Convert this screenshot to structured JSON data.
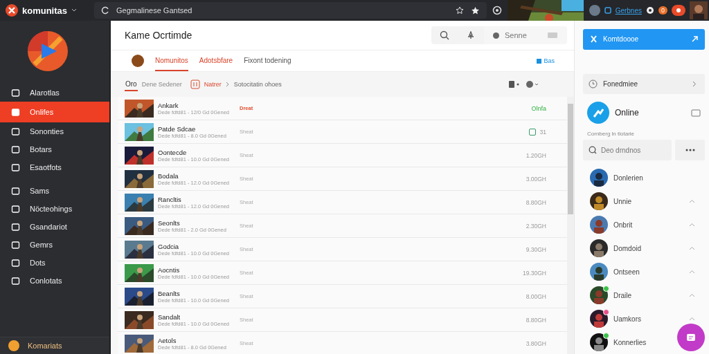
{
  "top_bar": {
    "brand": "komunitas",
    "address": "Gegmalinese Gantsed",
    "account": "Gerbnes",
    "notifications": "0"
  },
  "sidebar": {
    "items": [
      {
        "label": "Alarotlas",
        "selected": false
      },
      {
        "label": "Onlifes",
        "selected": true
      },
      {
        "label": "Sononties",
        "selected": false
      },
      {
        "label": "Botars",
        "selected": false
      },
      {
        "label": "Esaotfots",
        "selected": false
      },
      {
        "label": "Sams",
        "selected": false
      },
      {
        "label": "Nöcteohings",
        "selected": false
      },
      {
        "label": "Gsandariot",
        "selected": false
      },
      {
        "label": "Gemrs",
        "selected": false
      },
      {
        "label": "Dots",
        "selected": false
      },
      {
        "label": "Conlotats",
        "selected": false
      }
    ],
    "footer": "Komariats"
  },
  "main": {
    "title": "Kame Ocrtimde",
    "search_placeholder": "Senne",
    "tabs": [
      {
        "label": "Nomunitos",
        "selected": true
      },
      {
        "label": "Adotsbfare",
        "selected": false
      },
      {
        "label": "Fixont todening",
        "selected": false
      }
    ],
    "tabs_action": "Bas",
    "filter": {
      "label": "Oro",
      "hint": "Dene Sedener"
    },
    "breadcrumb": [
      "Natrer",
      "Sotocitatin ohoes"
    ],
    "rows": [
      {
        "title": "Ankark",
        "subtitle": "Dede fdfd81 - 12/0 Gd 0Gened",
        "tag": "Dreat",
        "tag_highlight": true,
        "kind": "status",
        "value": "Olnfa"
      },
      {
        "title": "Patde Sdcae",
        "subtitle": "Dede fdfd81 - 8.0 Gd 0Gened",
        "tag": "Sheat",
        "tag_highlight": false,
        "kind": "check",
        "checked": false,
        "value": "31"
      },
      {
        "title": "Oontecde",
        "subtitle": "Dede fdfd81 - 10.0 Gd 0Gened",
        "tag": "Sheat",
        "tag_highlight": false,
        "kind": "size",
        "value": "1.20GH"
      },
      {
        "title": "Bodala",
        "subtitle": "Dede fdfd81 - 12.0 Gd 0Gened",
        "tag": "Sheat",
        "tag_highlight": false,
        "kind": "size",
        "value": "3.00GH"
      },
      {
        "title": "Rancltis",
        "subtitle": "Dede fdfd81 - 12.0 Gd 0Gened",
        "tag": "Sheat",
        "tag_highlight": false,
        "kind": "size",
        "value": "8.80GH"
      },
      {
        "title": "Seonlts",
        "subtitle": "Dede fdfd81 - 2.0 Gd 0Gened",
        "tag": "Sheat",
        "tag_highlight": false,
        "kind": "size",
        "value": "2.30GH"
      },
      {
        "title": "Godcia",
        "subtitle": "Dede fdfd81 - 10.0 Gd 0Gened",
        "tag": "Sheat",
        "tag_highlight": false,
        "kind": "size",
        "value": "9.30GH"
      },
      {
        "title": "Aocntis",
        "subtitle": "Dede fdfd81 - 10.0 Gd 0Gened",
        "tag": "Sheat",
        "tag_highlight": false,
        "kind": "size",
        "value": "19.30GH"
      },
      {
        "title": "Beanlts",
        "subtitle": "Dede fdfd81 - 10.0 Gd 0Gened",
        "tag": "Sheat",
        "tag_highlight": false,
        "kind": "size",
        "value": "8.00GH"
      },
      {
        "title": "Sandalt",
        "subtitle": "Dede fdfd81 - 10.0 Gd 0Gened",
        "tag": "Sheat",
        "tag_highlight": false,
        "kind": "size",
        "value": "8.80GH"
      },
      {
        "title": "Aetols",
        "subtitle": "Dede fdfd81 - 8.0 Gd 0Gened",
        "tag": "Sheat",
        "tag_highlight": false,
        "kind": "size",
        "value": "3.80GH"
      }
    ]
  },
  "right_panel": {
    "primary_button": "Komtdoooe",
    "section": "Fonedmiee",
    "status": {
      "label": "Online",
      "caption": "Cornberg ln tlotarie"
    },
    "search_placeholder": "Deo drndnos",
    "contacts": [
      {
        "name": "Donlerien",
        "expanded": false
      },
      {
        "name": "Unnie",
        "expanded": true
      },
      {
        "name": "Onbrit",
        "expanded": true
      },
      {
        "name": "Domdoid",
        "expanded": true
      },
      {
        "name": "Ontseen",
        "expanded": true
      },
      {
        "name": "Draile",
        "expanded": true,
        "color": "#3cc24a"
      },
      {
        "name": "Uamkors",
        "expanded": true,
        "color": "#e8508a"
      },
      {
        "name": "Konnerlies",
        "expanded": false,
        "color": "#3cc24a"
      }
    ]
  }
}
